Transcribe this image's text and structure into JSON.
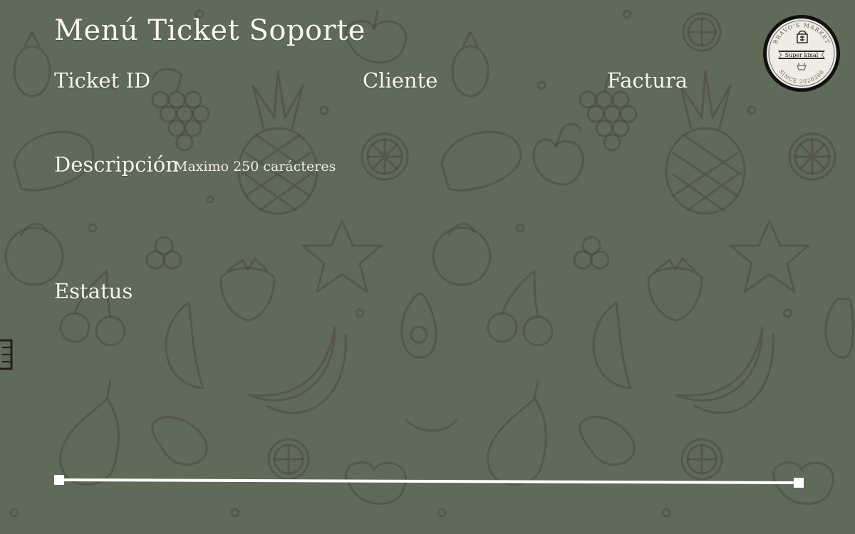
{
  "form": {
    "title": "Menú Ticket Soporte",
    "ticket_id_label": "Ticket ID",
    "cliente_label": "Cliente",
    "factura_label": "Factura",
    "descripcion_label": "Descripción",
    "descripcion_hint": "Maximo 250 carácteres",
    "estatus_label": "Estatus"
  },
  "logo": {
    "top_text": "BRAVO'S MARKET",
    "banner_text": "Super kinal",
    "bottom_text": "SINCE 2020286"
  },
  "colors": {
    "background": "#5f6a58",
    "pattern": "#4a4336",
    "text": "#f8f6ee",
    "slider": "#ffffff"
  },
  "icons": {
    "background": "fruit-pattern",
    "logo": "market-logo",
    "handle": "drag-handle"
  }
}
